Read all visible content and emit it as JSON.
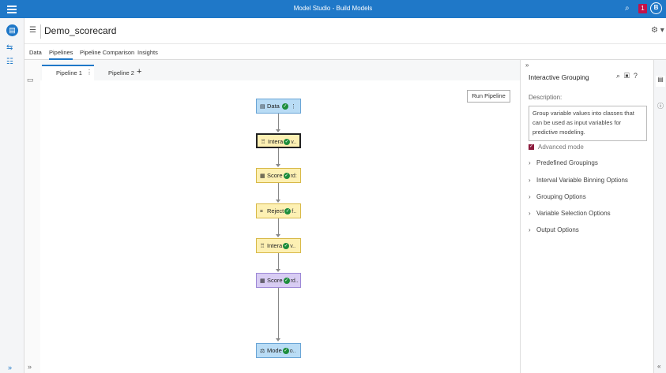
{
  "app": {
    "title": "Model Studio - Build Models",
    "notification_count": "1",
    "user_initial": "B"
  },
  "project": {
    "name": "Demo_scorecard"
  },
  "tabs": [
    "Data",
    "Pipelines",
    "Pipeline Comparison",
    "Insights"
  ],
  "pipeline_tabs": [
    "Pipeline 1",
    "Pipeline 2"
  ],
  "toolbar": {
    "run_label": "Run Pipeline"
  },
  "nodes": [
    {
      "label": "Data",
      "type": "data",
      "status": "complete"
    },
    {
      "label": "Intera",
      "suffix": "v..",
      "type": "yellow",
      "selected": true
    },
    {
      "label": "Score",
      "suffix": "rd:",
      "type": "yellow"
    },
    {
      "label": "Reject",
      "suffix": "f..",
      "type": "yellow"
    },
    {
      "label": "Intera",
      "suffix": "v..",
      "type": "yellow"
    },
    {
      "label": "Score",
      "suffix": "rd..",
      "type": "purple"
    },
    {
      "label": "Mode",
      "suffix": "o..",
      "type": "data"
    }
  ],
  "panel": {
    "title": "Interactive Grouping",
    "description_label": "Description:",
    "description": "Group variable values into classes that can be used as input variables for predictive modeling.",
    "advanced_mode_label": "Advanced mode",
    "advanced_mode_checked": true,
    "sections": [
      "Predefined Groupings",
      "Interval Variable Binning Options",
      "Grouping Options",
      "Variable Selection Options",
      "Output Options"
    ]
  },
  "colors": {
    "accent": "#1f78c8",
    "node_data": "#b9dcf5",
    "node_yellow": "#fdf0b3",
    "node_purple": "#d8ccf3",
    "status_ok": "#1d8d3c",
    "checkbox": "#8b1a3c"
  }
}
